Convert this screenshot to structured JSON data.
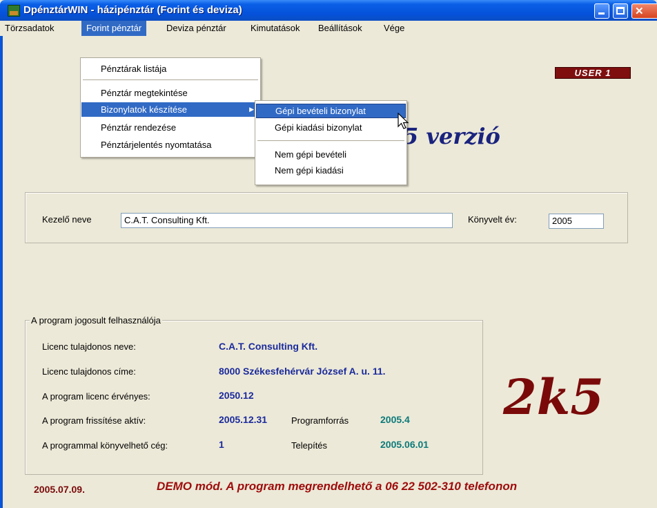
{
  "window": {
    "title": "DpénztárWIN - házipénztár (Forint és deviza)"
  },
  "menu": {
    "items": [
      {
        "label": "Törzsadatok"
      },
      {
        "label": "Forint pénztár"
      },
      {
        "label": "Deviza pénztár"
      },
      {
        "label": "Kimutatások"
      },
      {
        "label": "Beállítások"
      },
      {
        "label": "Vége"
      }
    ]
  },
  "dropdown": {
    "items": [
      {
        "label": "Pénztárak listája"
      },
      {
        "label": "Pénztár megtekintése"
      },
      {
        "label": "Bizonylatok készítése"
      },
      {
        "label": "Pénztár rendezése"
      },
      {
        "label": "Pénztárjelentés nyomtatása"
      }
    ]
  },
  "submenu": {
    "items": [
      {
        "label": "Gépi bevételi bizonylat"
      },
      {
        "label": "Gépi kiadási bizonylat"
      },
      {
        "label": "Nem gépi bevételi"
      },
      {
        "label": "Nem gépi kiadási"
      }
    ]
  },
  "user_badge": "USER 1",
  "version_text": "5 verzió",
  "operator": {
    "name_label": "Kezelő neve",
    "name_value": "C.A.T. Consulting Kft.",
    "year_label": "Könyvelt év:",
    "year_value": "2005"
  },
  "license": {
    "legend": "A program jogosult felhasználója",
    "owner_name_label": "Licenc tulajdonos neve:",
    "owner_name_value": "C.A.T. Consulting Kft.",
    "owner_address_label": "Licenc tulajdonos címe:",
    "owner_address_value": "8000 Székesfehérvár József A. u. 11.",
    "valid_label": "A program licenc érvényes:",
    "valid_value": "2050.12",
    "update_label": "A program frissítése aktív:",
    "update_value": "2005.12.31",
    "source_label": "Programforrás",
    "source_value": "2005.4",
    "companies_label": "A programmal könyvelhető cég:",
    "companies_value": "1",
    "install_label": "Telepítés",
    "install_value": "2005.06.01"
  },
  "logo_text": "2k5",
  "status": {
    "date": "2005.07.09.",
    "demo_message": "DEMO mód. A program megrendelhető a 06 22 502-310 telefonon"
  },
  "colors": {
    "title_bar": "#0551d9",
    "menu_highlight": "#316ac5",
    "license_value": "#1a2a9c",
    "license_value_alt": "#0c7a7a",
    "logo": "#7a0a0a",
    "version": "#1a237e"
  }
}
